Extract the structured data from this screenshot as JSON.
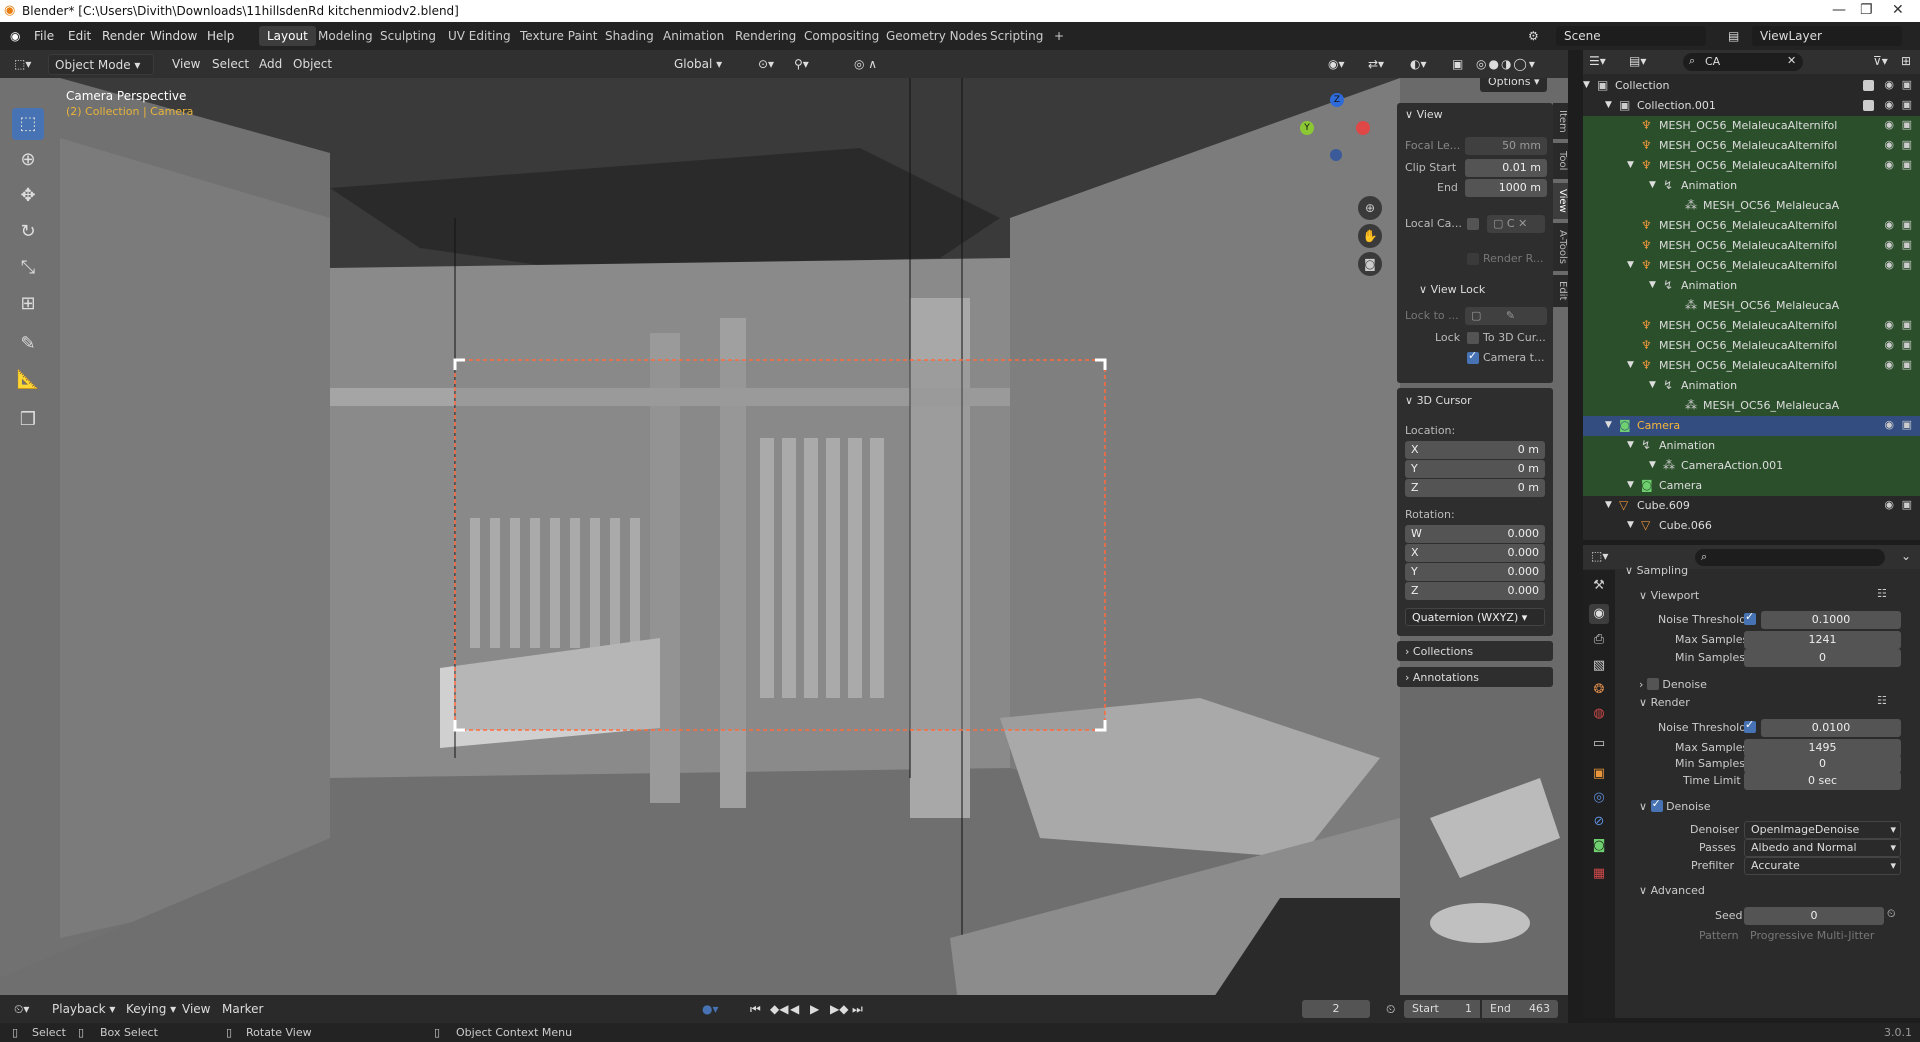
{
  "window": {
    "title": "Blender* [C:\\Users\\Divith\\Downloads\\11hillsdenRd kitchenmiodv2.blend]"
  },
  "menu": [
    "File",
    "Edit",
    "Render",
    "Window",
    "Help"
  ],
  "workspaces": [
    "Layout",
    "Modeling",
    "Sculpting",
    "UV Editing",
    "Texture Paint",
    "Shading",
    "Animation",
    "Rendering",
    "Compositing",
    "Geometry Nodes",
    "Scripting",
    "+"
  ],
  "scene": {
    "name": "Scene",
    "view_layer": "ViewLayer"
  },
  "viewport_header": {
    "mode": "Object Mode",
    "view": "View",
    "select": "Select",
    "add": "Add",
    "object": "Object",
    "orientation": "Global",
    "options": "Options"
  },
  "viewport": {
    "overlay_title": "Camera Perspective",
    "overlay_sub": "(2) Collection | Camera",
    "gizmo": {
      "z": "Z",
      "y": "Y"
    }
  },
  "npanel": {
    "view": {
      "header": "View",
      "focal_label": "Focal Le...",
      "focal": "50 mm",
      "clip_start_label": "Clip Start",
      "clip_start": "0.01 m",
      "end_label": "End",
      "end": "1000 m",
      "local_cam_label": "Local Ca...",
      "local_cam_val": "C",
      "render_region": "Render R..."
    },
    "view_lock": {
      "header": "View Lock",
      "lock_to": "Lock to ...",
      "lock_label": "Lock",
      "to_cursor": "To 3D Cur...",
      "camera": "Camera t..."
    },
    "cursor": {
      "header": "3D Cursor",
      "location": "Location:",
      "x": "0 m",
      "y": "0 m",
      "z": "0 m",
      "rotation": "Rotation:",
      "rw": "0.000",
      "rx": "0.000",
      "ry": "0.000",
      "rz": "0.000",
      "mode": "Quaternion (WXYZ)"
    },
    "collections": "Collections",
    "annotations": "Annotations"
  },
  "side_tabs": [
    "Item",
    "Tool",
    "View",
    "A-Tools",
    "Edit"
  ],
  "outliner": {
    "search": "CA",
    "rows": [
      {
        "name": "Collection",
        "indent": 0,
        "icon": "▣"
      },
      {
        "name": "Collection.001",
        "indent": 1,
        "icon": "▣"
      },
      {
        "name": "MESH_OC56_MelaleucaAlternifol",
        "indent": 2,
        "icon": "♆"
      },
      {
        "name": "MESH_OC56_MelaleucaAlternifol",
        "indent": 2,
        "icon": "♆"
      },
      {
        "name": "MESH_OC56_MelaleucaAlternifol",
        "indent": 2,
        "icon": "♆"
      },
      {
        "name": "Animation",
        "indent": 3,
        "icon": "↯"
      },
      {
        "name": "MESH_OC56_MelaleucaA",
        "indent": 4,
        "icon": "⁂"
      },
      {
        "name": "MESH_OC56_MelaleucaAlternifol",
        "indent": 2,
        "icon": "♆"
      },
      {
        "name": "MESH_OC56_MelaleucaAlternifol",
        "indent": 2,
        "icon": "♆"
      },
      {
        "name": "MESH_OC56_MelaleucaAlternifol",
        "indent": 2,
        "icon": "♆"
      },
      {
        "name": "Animation",
        "indent": 3,
        "icon": "↯"
      },
      {
        "name": "MESH_OC56_MelaleucaA",
        "indent": 4,
        "icon": "⁂"
      },
      {
        "name": "MESH_OC56_MelaleucaAlternifol",
        "indent": 2,
        "icon": "♆"
      },
      {
        "name": "MESH_OC56_MelaleucaAlternifol",
        "indent": 2,
        "icon": "♆"
      },
      {
        "name": "MESH_OC56_MelaleucaAlternifol",
        "indent": 2,
        "icon": "♆"
      },
      {
        "name": "Animation",
        "indent": 3,
        "icon": "↯"
      },
      {
        "name": "MESH_OC56_MelaleucaA",
        "indent": 4,
        "icon": "⁂"
      },
      {
        "name": "Camera",
        "indent": 1,
        "icon": "◙"
      },
      {
        "name": "Animation",
        "indent": 2,
        "icon": "↯"
      },
      {
        "name": "CameraAction.001",
        "indent": 3,
        "icon": "⁂"
      },
      {
        "name": "Camera",
        "indent": 2,
        "icon": "◙"
      },
      {
        "name": "Cube.609",
        "indent": 1,
        "icon": "▽"
      },
      {
        "name": "Cube.066",
        "indent": 2,
        "icon": "▽"
      }
    ]
  },
  "properties": {
    "sampling": "Sampling",
    "viewport": "Viewport",
    "noise_threshold_label": "Noise Threshold",
    "vp_noise": "0.1000",
    "max_samples_label": "Max Samples",
    "vp_max": "1241",
    "min_samples_label": "Min Samples",
    "vp_min": "0",
    "denoise": "Denoise",
    "render": "Render",
    "r_noise": "0.0100",
    "r_max": "1495",
    "r_min": "0",
    "time_limit_label": "Time Limit",
    "r_time": "0 sec",
    "denoiser_label": "Denoiser",
    "denoiser": "OpenImageDenoise",
    "passes_label": "Passes",
    "passes": "Albedo and Normal",
    "prefilter_label": "Prefilter",
    "prefilter": "Accurate",
    "advanced": "Advanced",
    "seed_label": "Seed",
    "seed": "0",
    "pattern_label": "Pattern",
    "pattern": "Progressive Multi-Jitter"
  },
  "timeline": {
    "playback": "Playback",
    "keying": "Keying",
    "view": "View",
    "marker": "Marker",
    "frame": "2",
    "start_label": "Start",
    "start": "1",
    "end_label": "End",
    "end": "463"
  },
  "statusbar": {
    "select": "Select",
    "box_select": "Box Select",
    "rotate": "Rotate View",
    "context": "Object Context Menu",
    "version": "3.0.1"
  },
  "colors": {
    "accent": "#4772b3",
    "selected_row": "#334d80",
    "green_row": "#2b4f2b",
    "camera_frame": "#ff6a3d"
  }
}
